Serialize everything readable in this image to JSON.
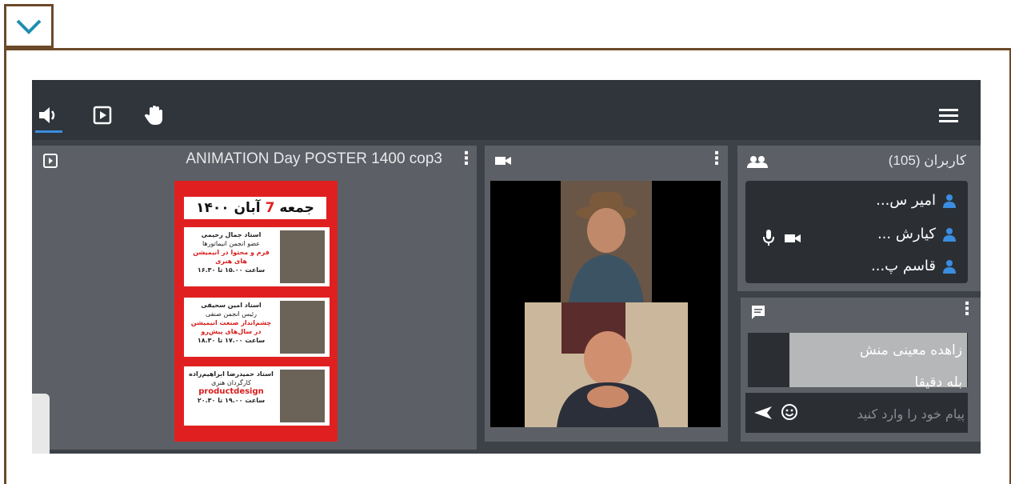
{
  "topbar": {
    "icons": [
      "speaker-icon",
      "present-icon",
      "raise-hand-icon",
      "menu-icon"
    ]
  },
  "presentation": {
    "title": "ANIMATION Day POSTER 1400 cop3",
    "poster": {
      "header_prefix": "جمعه",
      "header_day": "7",
      "header_suffix": "آبان ۱۴۰۰",
      "speakers": [
        {
          "name": "استاد جمال رحیمی",
          "role": "عضو انجمن انیماتورها",
          "topic": "فرم و محتوا در انیمیشن های هنری",
          "time": "ساعت ۱۵.۰۰ تا ۱۶.۳۰"
        },
        {
          "name": "استاد امین سحیفی",
          "role": "رئیس انجمن صنفی",
          "topic": "چشم‌انداز صنعت انیمیشن در سال‌های پیش‌رو",
          "time": "ساعت ۱۷.۰۰ تا ۱۸.۳۰"
        },
        {
          "name": "استاد حمیدرضا ابراهیم‌زاده",
          "role": "کارگردان هنری",
          "topic": "productdesign",
          "time": "ساعت ۱۹.۰۰ تا ۲۰.۳۰"
        }
      ]
    }
  },
  "video": {
    "icon": "camera-icon"
  },
  "users": {
    "title": "کاربران (105)",
    "list": [
      {
        "name": "امیر س..."
      },
      {
        "name": "کیارش ..."
      },
      {
        "name": "قاسم پ..."
      }
    ]
  },
  "chat": {
    "message_author": "زاهده معینی منش",
    "message_text": "بله دقیقا",
    "placeholder": "پیام خود را وارد کنید"
  }
}
